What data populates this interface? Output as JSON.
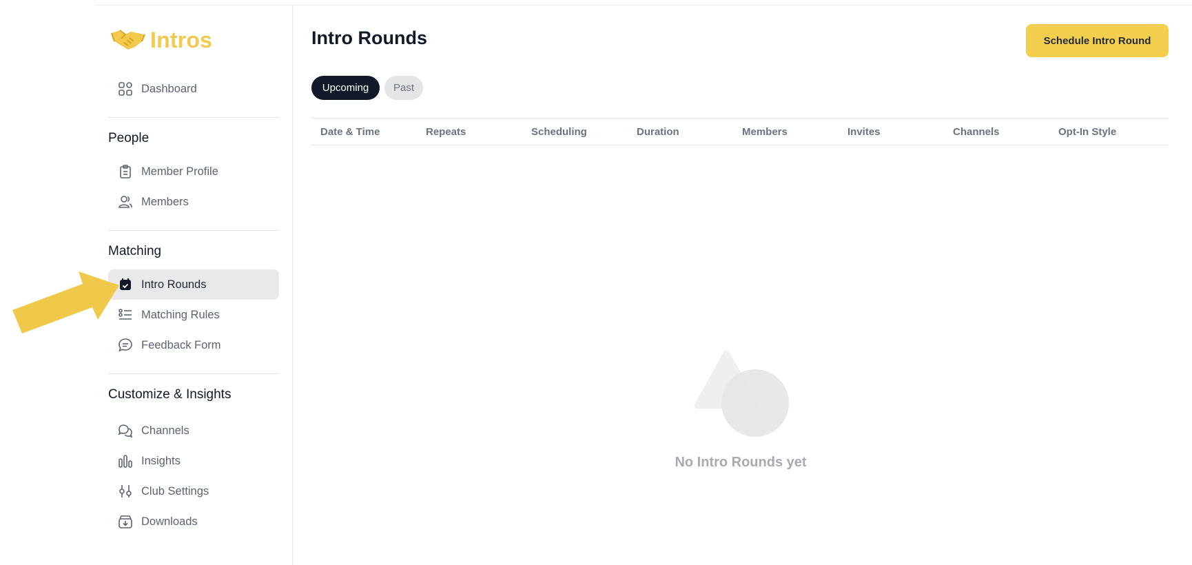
{
  "app": {
    "name": "Intros"
  },
  "sidebar": {
    "dashboard": {
      "label": "Dashboard",
      "icon": "dashboard-grid-icon"
    },
    "sections": [
      {
        "title": "People",
        "items": [
          {
            "label": "Member Profile",
            "icon": "clipboard-icon"
          },
          {
            "label": "Members",
            "icon": "users-icon"
          }
        ]
      },
      {
        "title": "Matching",
        "items": [
          {
            "label": "Intro Rounds",
            "icon": "calendar-check-icon",
            "active": true
          },
          {
            "label": "Matching Rules",
            "icon": "list-rules-icon"
          },
          {
            "label": "Feedback Form",
            "icon": "chat-bubble-icon"
          }
        ]
      },
      {
        "title": "Customize & Insights",
        "items": [
          {
            "label": "Channels",
            "icon": "chat-bubbles-icon"
          },
          {
            "label": "Insights",
            "icon": "bar-chart-icon"
          },
          {
            "label": "Club Settings",
            "icon": "sliders-icon"
          },
          {
            "label": "Downloads",
            "icon": "download-box-icon"
          }
        ]
      }
    ]
  },
  "main": {
    "title": "Intro Rounds",
    "primary_button": "Schedule Intro Round",
    "tabs": [
      {
        "label": "Upcoming",
        "active": true
      },
      {
        "label": "Past",
        "active": false
      }
    ],
    "table": {
      "columns": [
        "Date & Time",
        "Repeats",
        "Scheduling",
        "Duration",
        "Members",
        "Invites",
        "Channels",
        "Opt-In Style"
      ]
    },
    "empty_state": "No Intro Rounds yet"
  },
  "colors": {
    "accent": "#f4cf4f",
    "tab_active": "#111827",
    "nav_active_bg": "#e9e9ec",
    "annotation_arrow": "#f0c94b"
  }
}
